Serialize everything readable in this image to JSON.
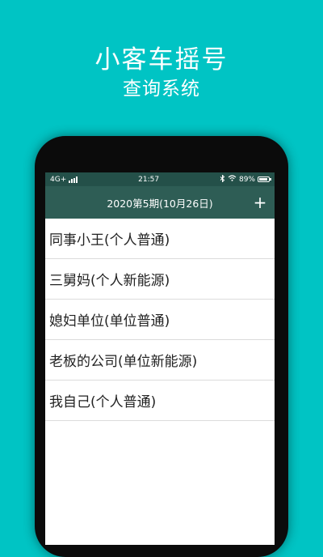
{
  "promo": {
    "title": "小客车摇号",
    "subtitle": "查询系统"
  },
  "status_bar": {
    "network": "4G+",
    "time": "21:57",
    "battery_text": "89%",
    "battery_level": 0.89,
    "icons": [
      "signal-icon",
      "bluetooth-icon",
      "wifi-icon",
      "battery-icon"
    ]
  },
  "app_bar": {
    "title": "2020第5期(10月26日)",
    "add_label": "+"
  },
  "entries": [
    {
      "label": "同事小王(个人普通)"
    },
    {
      "label": "三舅妈(个人新能源)"
    },
    {
      "label": "媳妇单位(单位普通)"
    },
    {
      "label": "老板的公司(单位新能源)"
    },
    {
      "label": "我自己(个人普通)"
    }
  ],
  "colors": {
    "background": "#00c4c4",
    "status_bar": "#245049",
    "app_bar": "#2e5d55"
  }
}
